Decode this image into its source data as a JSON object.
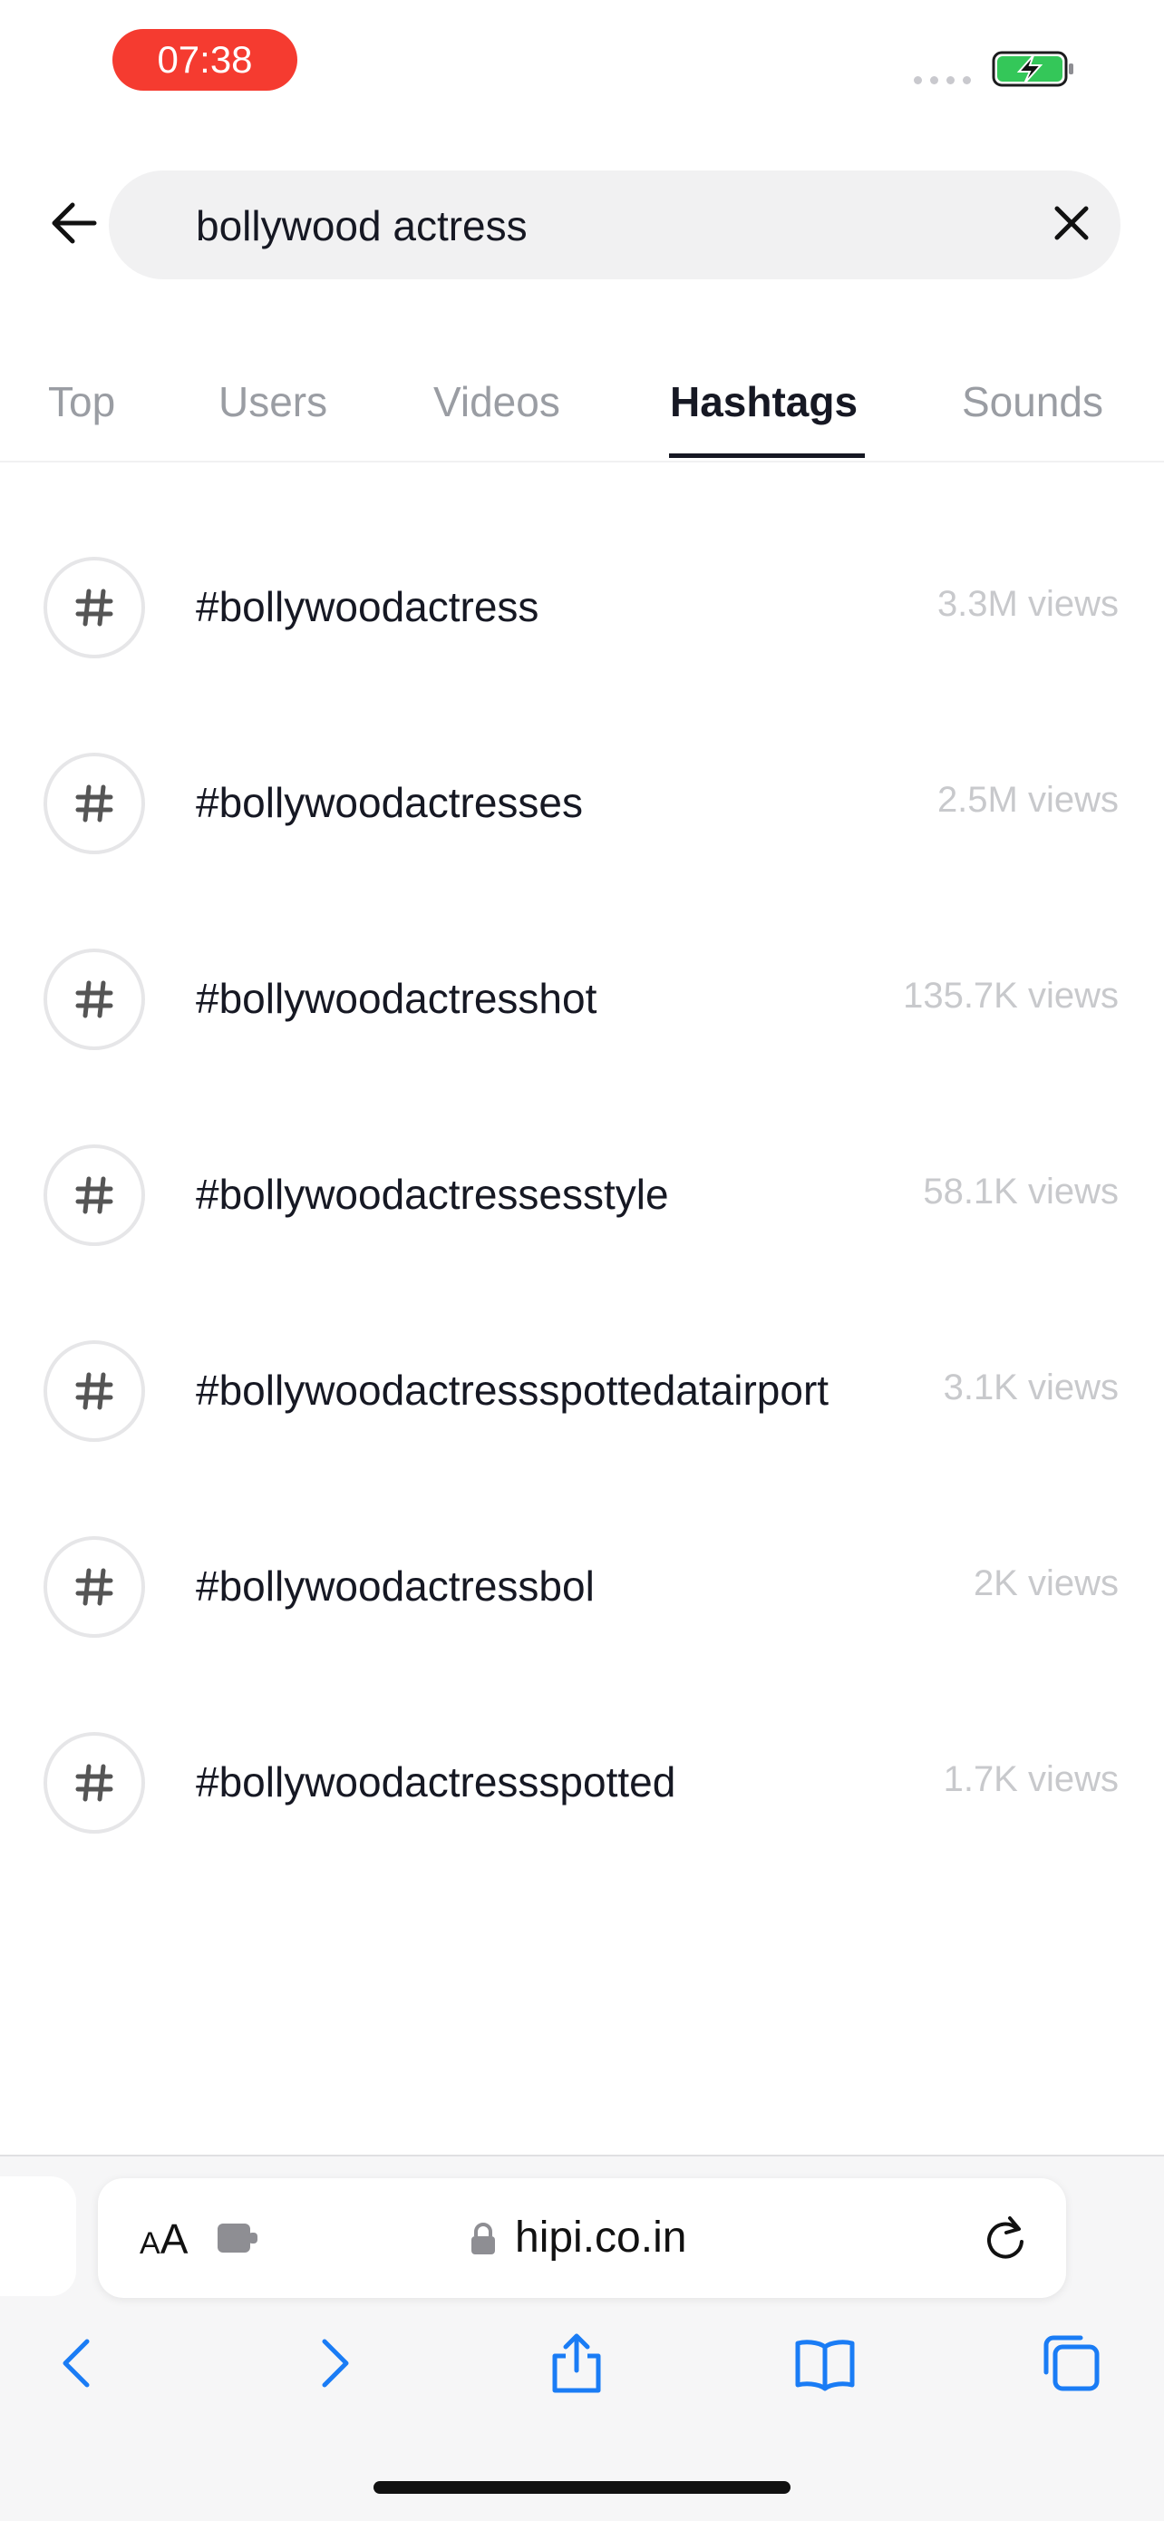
{
  "status_bar": {
    "time": "07:38"
  },
  "search": {
    "query": "bollywood actress"
  },
  "tabs": [
    {
      "label": "Top"
    },
    {
      "label": "Users"
    },
    {
      "label": "Videos"
    },
    {
      "label": "Hashtags"
    },
    {
      "label": "Sounds"
    }
  ],
  "active_tab": "Hashtags",
  "hashtags": [
    {
      "name": "#bollywoodactress",
      "views": "3.3M views"
    },
    {
      "name": "#bollywoodactresses",
      "views": "2.5M views"
    },
    {
      "name": "#bollywoodactresshot",
      "views": "135.7K views"
    },
    {
      "name": "#bollywoodactressesstyle",
      "views": "58.1K views"
    },
    {
      "name": "#bollywoodactressspottedatairport",
      "views": "3.1K views"
    },
    {
      "name": "#bollywoodactressbol",
      "views": "2K views"
    },
    {
      "name": "#bollywoodactressspotted",
      "views": "1.7K views"
    }
  ],
  "browser": {
    "aa_small": "A",
    "aa_large": "A",
    "url": "hipi.co.in"
  },
  "colors": {
    "time_pill": "#f53b30",
    "battery": "#34c759",
    "safari_blue": "#1a7cf5",
    "muted_text": "#9a9da3"
  },
  "icons": [
    "back-arrow-icon",
    "close-icon",
    "hashtag-icon",
    "extension-icon",
    "lock-icon",
    "reload-icon",
    "chevron-left-icon",
    "chevron-right-icon",
    "share-icon",
    "bookmarks-icon",
    "tabs-icon"
  ]
}
